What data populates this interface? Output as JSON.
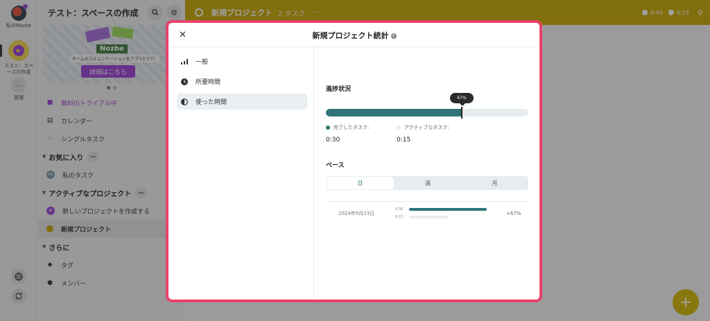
{
  "rail": {
    "user_label": "私のNozbe",
    "space_label": "テスト：スペースの作成",
    "manage_label": "管理"
  },
  "sidebar": {
    "title": "テスト：スペースの作成",
    "banner": {
      "logo": "Nozbe",
      "text": "チームのコミュニケーションをアプリ1つで！",
      "button": "詳細はこちら"
    },
    "trial": "無料のトライアル中",
    "calendar": "カレンダー",
    "single_tasks": "シングルタスク",
    "favorites_header": "お気に入り",
    "my_tasks": "私のタスク",
    "my_tasks_avatar": "DK",
    "active_projects_header": "アクティブなプロジェクト",
    "new_project": "新しいプロジェクトを作成する",
    "project_item": "新規プロジェクト",
    "more_header": "さらに",
    "tags": "タグ",
    "members": "メンバー"
  },
  "topbar": {
    "project": "新規プロジェクト",
    "task_count": "2 タスク",
    "time_total": "0:45",
    "time_used": "0:15"
  },
  "modal": {
    "title": "新規プロジェクト統計",
    "nav": [
      {
        "label": "一般"
      },
      {
        "label": "所要時間"
      },
      {
        "label": "使った時間"
      }
    ],
    "progress": {
      "heading": "進捗状況",
      "percent_label": "67%",
      "percent": 67,
      "completed_label": "完了したタスク:",
      "completed_value": "0:30",
      "active_label": "アクティブなタスク:",
      "active_value": "0:15"
    },
    "base": {
      "heading": "ベース",
      "tabs": [
        "日",
        "週",
        "月"
      ],
      "selected_tab": "日"
    },
    "breakdown": {
      "date": "2024年9月23日",
      "completed": "0:30",
      "active": "0:15",
      "completed_fraction": 1.0,
      "active_fraction": 0.5,
      "change": "+67%"
    }
  },
  "colors": {
    "accent": "#2f7478",
    "topbar": "#c9a800",
    "frame": "#e8436a",
    "brand_purple": "#9b3fd6"
  }
}
